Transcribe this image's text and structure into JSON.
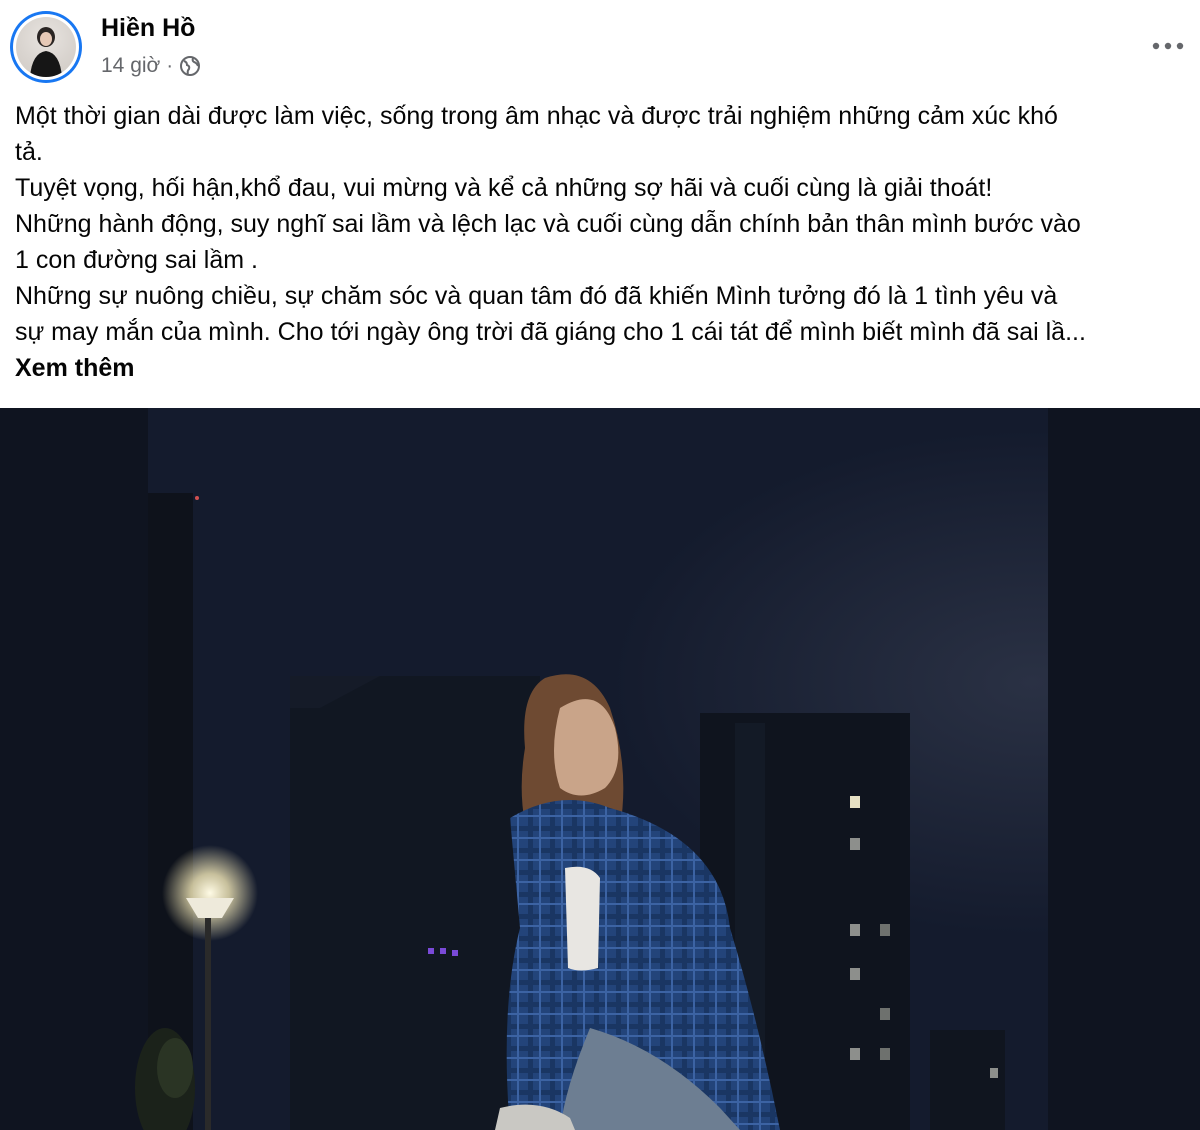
{
  "post": {
    "author": "Hiền Hồ",
    "time": "14 giờ",
    "separator": "·",
    "privacy_icon": "globe-icon",
    "more_icon": "more-horizontal-icon",
    "text_lines": [
      "Một thời gian dài được làm việc, sống trong âm nhạc và được trải nghiệm những cảm xúc khó",
      "tả.",
      "Tuyệt vọng, hối hận,khổ đau, vui mừng và kể cả những sợ hãi và cuối cùng là giải thoát!",
      "Những hành động, suy nghĩ sai lầm và lệch lạc và cuối cùng dẫn chính bản thân mình bước vào",
      "1 con đường sai lầm .",
      "Những sự nuông chiều, sự chăm sóc và quan tâm đó đã khiến Mình tưởng đó là 1 tình yêu và",
      "sự may mắn của mình. Cho tới ngày ông trời đã giáng cho 1 cái tát để mình biết mình đã sai lầ..."
    ],
    "see_more": "Xem thêm"
  },
  "colors": {
    "text_primary": "#050505",
    "text_secondary": "#65676b",
    "avatar_ring": "#1877f2",
    "night_sky": "#121a2c"
  }
}
